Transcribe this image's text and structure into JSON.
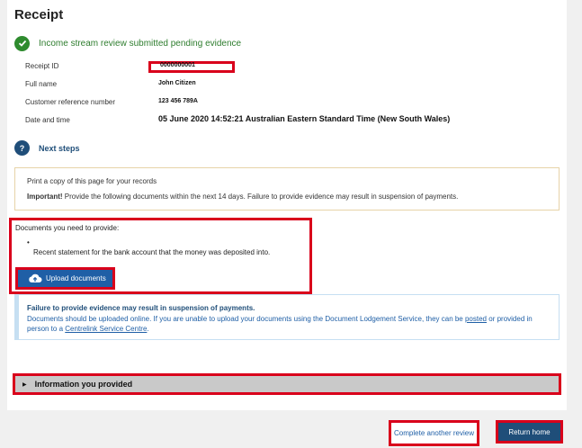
{
  "page": {
    "title": "Receipt"
  },
  "status": {
    "message": "Income stream review submitted pending evidence"
  },
  "details": [
    {
      "label": "Receipt ID",
      "value": "0000000001"
    },
    {
      "label": "Full name",
      "value": "John Citizen"
    },
    {
      "label": "Customer reference number",
      "value": "123 456 789A"
    },
    {
      "label": "Date and time",
      "value": "05 June 2020 14:52:21 Australian Eastern Standard Time (New South Wales)"
    }
  ],
  "next_steps": {
    "icon_text": "?",
    "title": "Next steps",
    "print_note": "Print a copy of this page for your records",
    "important_label": "Important!",
    "important_text": " Provide the following documents within the next 14 days. Failure to provide evidence may result in suspension of payments."
  },
  "documents": {
    "title": "Documents you need to provide:",
    "bullet": "•",
    "items": [
      "Recent statement for the bank account that the money was deposited into."
    ],
    "upload_label": "Upload documents"
  },
  "warning": {
    "title": "Failure to provide evidence may result in suspension of payments.",
    "text_a": "Documents should be uploaded online. If you are unable to upload your documents using the Document Lodgement Service, they can be ",
    "link_posted": "posted",
    "text_b": " or provided in person to a ",
    "link_centre": "Centrelink Service Centre",
    "text_c": "."
  },
  "accordion": {
    "label": "Information you provided"
  },
  "actions": {
    "another_review": "Complete another review",
    "return_home": "Return home"
  },
  "colors": {
    "primary": "#1f4e79",
    "success": "#2e8b2e",
    "highlight": "#d9001b"
  },
  "icons": {
    "status": "check-circle-icon",
    "next_steps": "question-circle-icon",
    "upload": "cloud-upload-icon",
    "accordion": "caret-right-icon"
  }
}
